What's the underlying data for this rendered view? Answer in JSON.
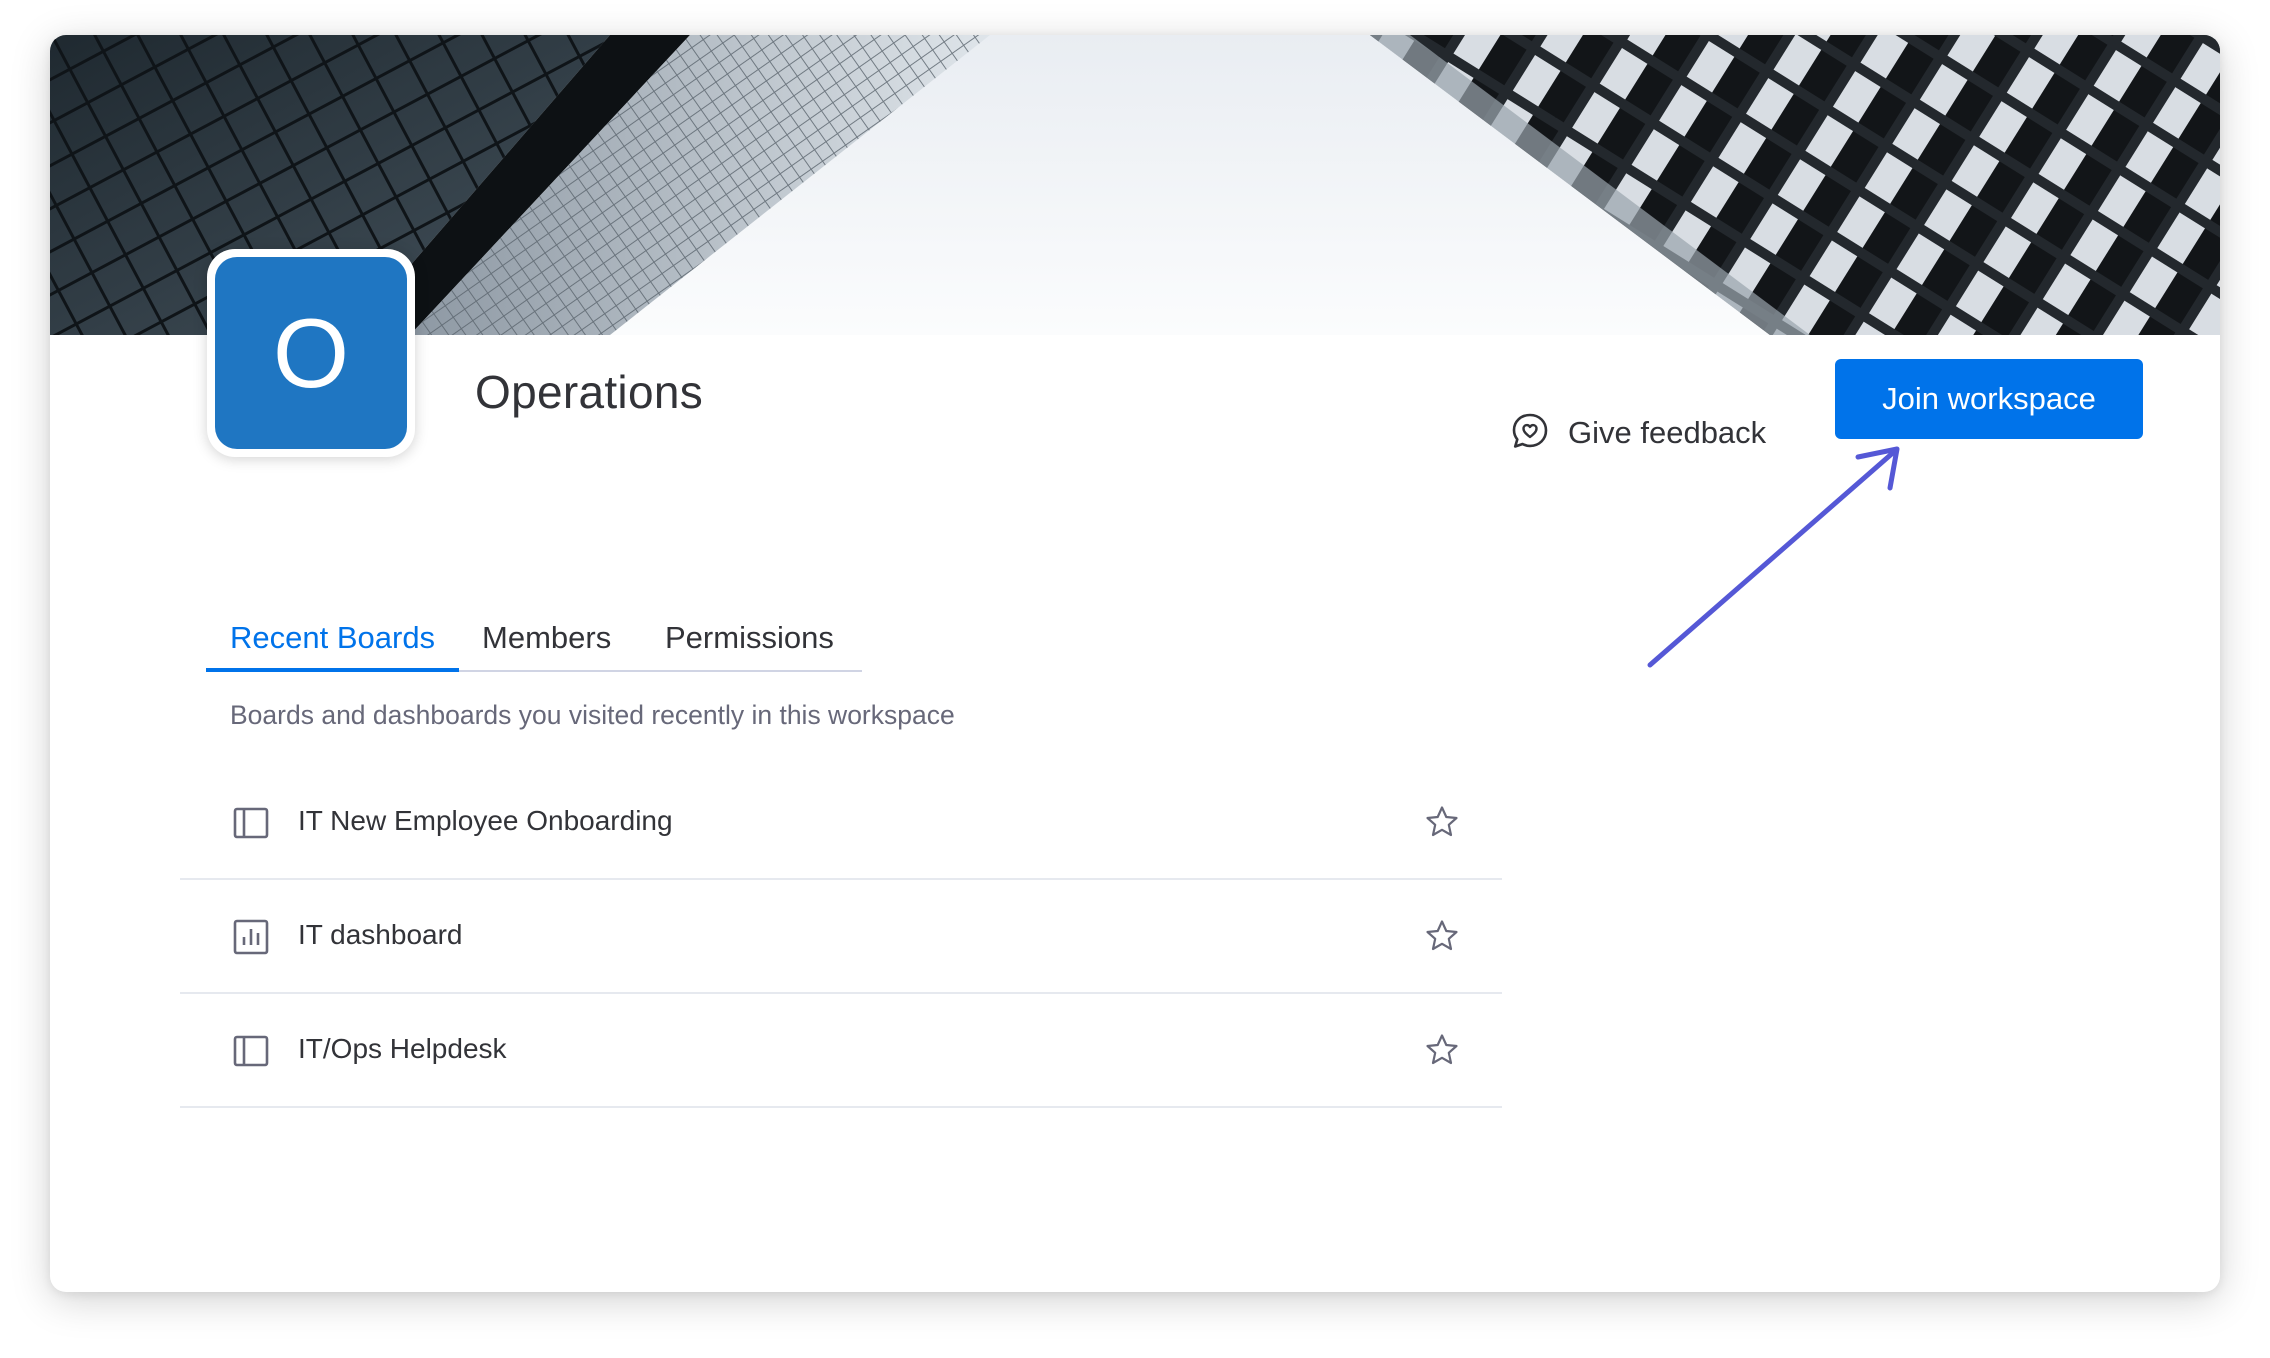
{
  "workspace": {
    "logo_letter": "O",
    "name": "Operations",
    "feedback_label": "Give feedback",
    "join_label": "Join workspace"
  },
  "tabs": [
    {
      "label": "Recent Boards",
      "active": true
    },
    {
      "label": "Members",
      "active": false
    },
    {
      "label": "Permissions",
      "active": false
    }
  ],
  "recent": {
    "description": "Boards and dashboards you visited recently in this workspace",
    "items": [
      {
        "label": "IT New Employee Onboarding",
        "icon": "board-icon"
      },
      {
        "label": "IT dashboard",
        "icon": "dashboard-icon"
      },
      {
        "label": "IT/Ops Helpdesk",
        "icon": "board-icon"
      }
    ]
  },
  "colors": {
    "accent": "#0073ea",
    "logo_bg": "#1f76c2",
    "annotation_arrow": "#5558d6",
    "text": "#323338",
    "muted_text": "#676879"
  }
}
